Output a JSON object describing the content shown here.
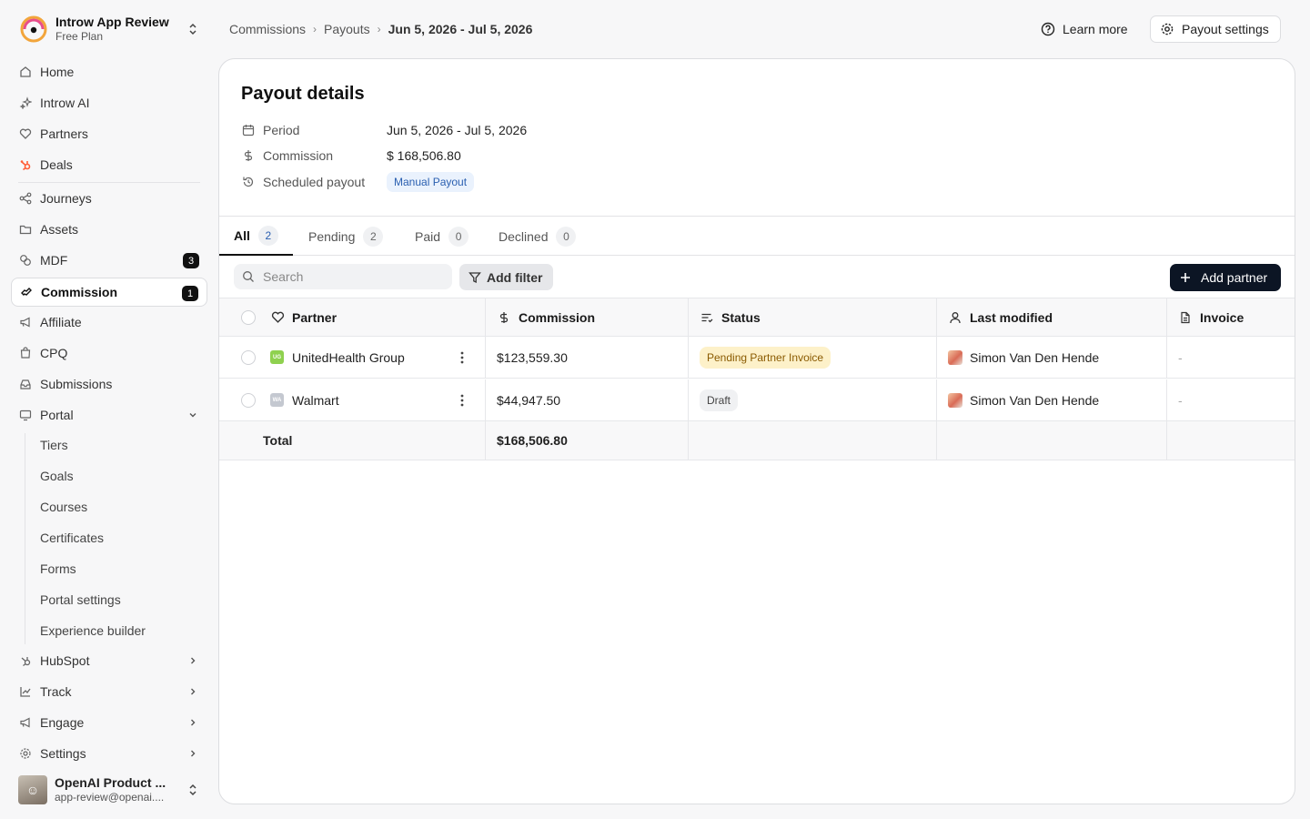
{
  "workspace": {
    "name": "Introw App Review",
    "plan": "Free Plan"
  },
  "nav": {
    "home": "Home",
    "introw_ai": "Introw AI",
    "partners": "Partners",
    "deals": "Deals",
    "journeys": "Journeys",
    "assets": "Assets",
    "mdf": "MDF",
    "mdf_badge": "3",
    "commission": "Commission",
    "commission_badge": "1",
    "affiliate": "Affiliate",
    "cpq": "CPQ",
    "submissions": "Submissions",
    "portal": "Portal",
    "portal_sub": {
      "tiers": "Tiers",
      "goals": "Goals",
      "courses": "Courses",
      "certificates": "Certificates",
      "forms": "Forms",
      "portal_settings": "Portal settings",
      "experience_builder": "Experience builder"
    },
    "hubspot": "HubSpot",
    "track": "Track",
    "engage": "Engage",
    "settings": "Settings"
  },
  "user": {
    "name": "OpenAI Product ...",
    "email": "app-review@openai...."
  },
  "breadcrumb": {
    "level1": "Commissions",
    "level2": "Payouts",
    "current": "Jun 5, 2026 - Jul 5, 2026"
  },
  "header": {
    "learn_more": "Learn more",
    "payout_settings": "Payout settings"
  },
  "details": {
    "title": "Payout details",
    "period_label": "Period",
    "period_value": "Jun 5, 2026 - Jul 5, 2026",
    "commission_label": "Commission",
    "commission_value": "$ 168,506.80",
    "scheduled_label": "Scheduled payout",
    "scheduled_value": "Manual Payout"
  },
  "tabs": [
    {
      "label": "All",
      "count": "2"
    },
    {
      "label": "Pending",
      "count": "2"
    },
    {
      "label": "Paid",
      "count": "0"
    },
    {
      "label": "Declined",
      "count": "0"
    }
  ],
  "toolbar": {
    "search_placeholder": "Search",
    "add_filter": "Add filter",
    "add_partner": "Add partner"
  },
  "table": {
    "columns": {
      "partner": "Partner",
      "commission": "Commission",
      "status": "Status",
      "last_modified": "Last modified",
      "invoice": "Invoice"
    },
    "rows": [
      {
        "partner": "UnitedHealth Group",
        "logo_text": "UG",
        "logo_color": "#8fd14f",
        "commission": "$123,559.30",
        "status": "Pending Partner Invoice",
        "modified_by": "Simon Van Den Hende",
        "invoice": "-"
      },
      {
        "partner": "Walmart",
        "logo_text": "WA",
        "logo_color": "#c4c8d0",
        "commission": "$44,947.50",
        "status": "Draft",
        "modified_by": "Simon Van Den Hende",
        "invoice": "-"
      }
    ],
    "total_label": "Total",
    "total_value": "$168,506.80"
  }
}
